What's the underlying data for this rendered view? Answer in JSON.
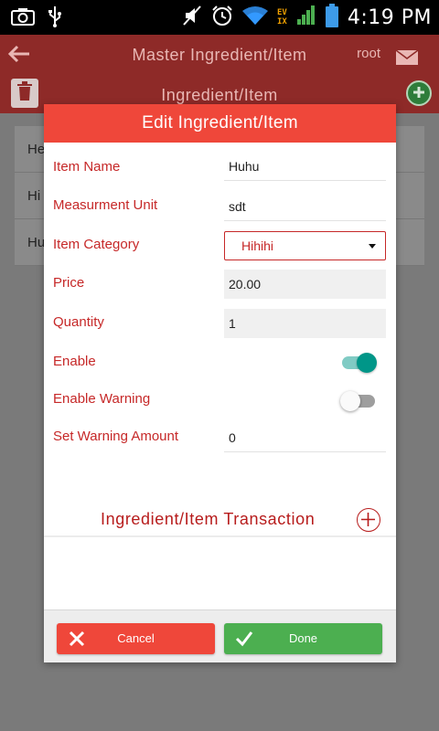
{
  "status_bar": {
    "time": "4:19 PM",
    "network_label_top": "EV",
    "network_label_bottom": "IX",
    "icons": [
      "screenshot-icon",
      "usb-icon",
      "mute-icon",
      "alarm-icon",
      "wifi-icon",
      "signal-icon",
      "battery-icon"
    ]
  },
  "app_bar": {
    "title": "Master Ingredient/Item",
    "user": "root",
    "subtitle": "Ingredient/Item"
  },
  "background_list": {
    "rows": [
      "He",
      "Hi",
      "Hu"
    ]
  },
  "dialog": {
    "title": "Edit Ingredient/Item",
    "fields": {
      "item_name": {
        "label": "Item Name",
        "value": "Huhu"
      },
      "measurement_unit": {
        "label": "Measurment Unit",
        "value": "sdt"
      },
      "item_category": {
        "label": "Item Category",
        "value": "Hihihi"
      },
      "price": {
        "label": "Price",
        "value": "20.00"
      },
      "quantity": {
        "label": "Quantity",
        "value": "1"
      },
      "enable": {
        "label": "Enable",
        "value": true
      },
      "enable_warning": {
        "label": "Enable Warning",
        "value": false
      },
      "set_warning_amount": {
        "label": "Set Warning Amount",
        "value": "0"
      }
    },
    "transaction_label": "Ingredient/Item Transaction",
    "cancel_label": "Cancel",
    "done_label": "Done"
  },
  "colors": {
    "accent_red": "#ef473a",
    "label_red": "#c62828",
    "toggle_on": "#009688",
    "done_green": "#4caf50"
  }
}
